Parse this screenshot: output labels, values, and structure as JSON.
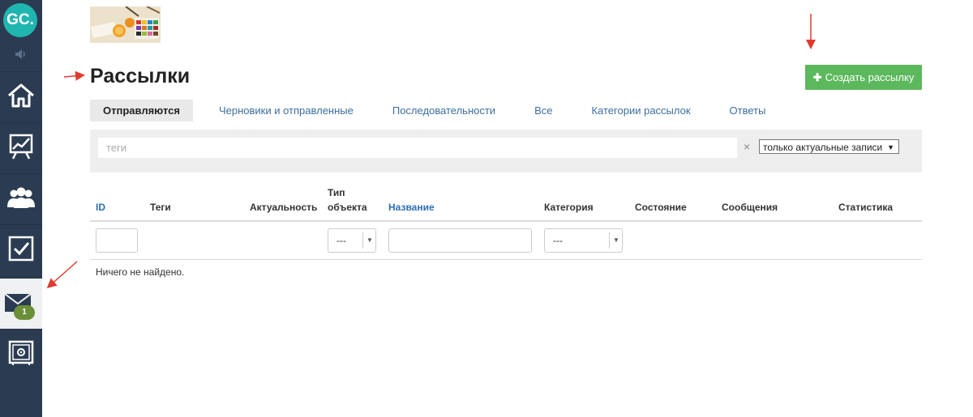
{
  "sidebar": {
    "logo": "GC.",
    "items": [
      {
        "icon": "home-icon"
      },
      {
        "icon": "chart-icon"
      },
      {
        "icon": "users-icon"
      },
      {
        "icon": "checkbox-icon"
      },
      {
        "icon": "mail-icon",
        "badge": "1",
        "active": true
      },
      {
        "icon": "safe-icon"
      }
    ]
  },
  "page": {
    "title": "Рассылки",
    "create_button": "Создать рассылку"
  },
  "tabs": [
    {
      "label": "Отправляются",
      "active": true
    },
    {
      "label": "Черновики и отправленные"
    },
    {
      "label": "Последовательности"
    },
    {
      "label": "Все"
    },
    {
      "label": "Категории рассылок"
    },
    {
      "label": "Ответы"
    }
  ],
  "filters": {
    "tags_placeholder": "теги",
    "clear": "×",
    "actuality_select": "только актуальные записи"
  },
  "table": {
    "columns": {
      "id": "ID",
      "tags": "Теги",
      "actuality": "Актуальность",
      "object_type_1": "Тип",
      "object_type_2": "объекта",
      "name": "Название",
      "category": "Категория",
      "state": "Состояние",
      "messages": "Сообщения",
      "stats": "Статистика"
    },
    "object_type_filter": "---",
    "category_filter": "---",
    "empty_message": "Ничего не найдено."
  },
  "colors": {
    "sidebar_bg": "#2b3c52",
    "logo_bg": "#1fb6b0",
    "create_button": "#5cb85c",
    "link": "#3c6e9e",
    "badge": "#6b8f36",
    "annotation_arrow": "#e03a2f"
  }
}
